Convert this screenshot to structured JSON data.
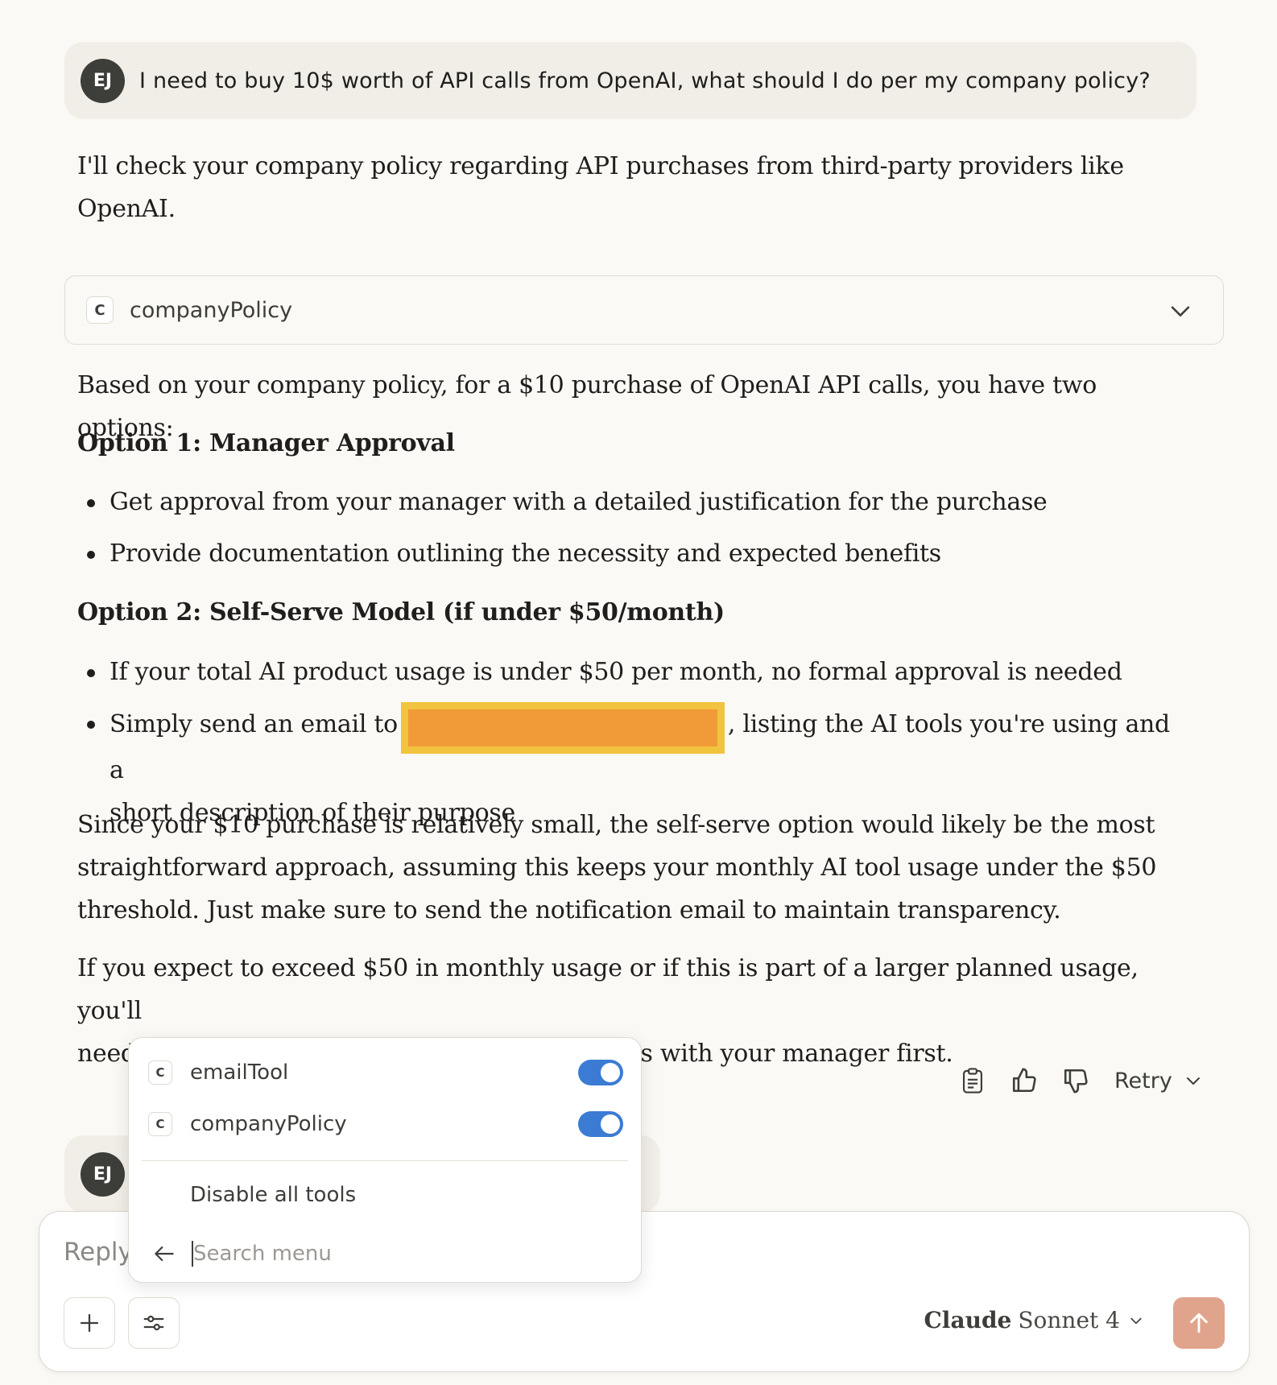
{
  "user_message": {
    "avatar_initials": "EJ",
    "text": "I need to buy 10$ worth of API calls from OpenAI, what should I do per my company policy?"
  },
  "assistant": {
    "intro": "I'll check your company policy regarding API purchases from third-party providers like OpenAI.",
    "tool_call": {
      "badge": "C",
      "name": "companyPolicy",
      "icon": "chevron-down-icon"
    },
    "summary": "Based on your company policy, for a $10 purchase of OpenAI API calls, you have two options:",
    "option1": {
      "heading": "Option 1: Manager Approval",
      "bullets": [
        "Get approval from your manager with a detailed justification for the purchase",
        "Provide documentation outlining the necessity and expected benefits"
      ]
    },
    "option2": {
      "heading": "Option 2: Self-Serve Model (if under $50/month)",
      "bullet1": "If your total AI product usage is under $50 per month, no formal approval is needed",
      "bullet2_before": "Simply send an email to",
      "bullet2_after": ", listing the AI tools you're using and a",
      "bullet2_line2": "short description of their purpose"
    },
    "para1_line1": "Since your $10 purchase is relatively small, the self-serve option would likely be the most",
    "para1_line2": "straightforward approach, assuming this keeps your monthly AI tool usage under the $50",
    "para1_line3": "threshold. Just make sure to send the notification email to maintain transparency.",
    "para2_line1": "If you expect to exceed $50 in monthly usage or if this is part of a larger planned usage, you'll",
    "para2_line2": "need to go through the formal approval process with your manager first."
  },
  "actions": {
    "icons": [
      "copy-icon",
      "thumbs-up-icon",
      "thumbs-down-icon"
    ],
    "retry_label": "Retry"
  },
  "user_message2": {
    "avatar_initials": "EJ"
  },
  "tools_menu": {
    "items": [
      {
        "badge": "C",
        "label": "emailTool",
        "enabled": true
      },
      {
        "badge": "C",
        "label": "companyPolicy",
        "enabled": true
      }
    ],
    "disable_all_label": "Disable all tools",
    "search_placeholder": "Search menu"
  },
  "composer": {
    "placeholder": "Reply",
    "model_brand": "Claude",
    "model_name": "Sonnet 4",
    "colors": {
      "send": "#e0a48c",
      "toggle_on": "#3b7bd4",
      "redaction": "#f19a38"
    }
  }
}
